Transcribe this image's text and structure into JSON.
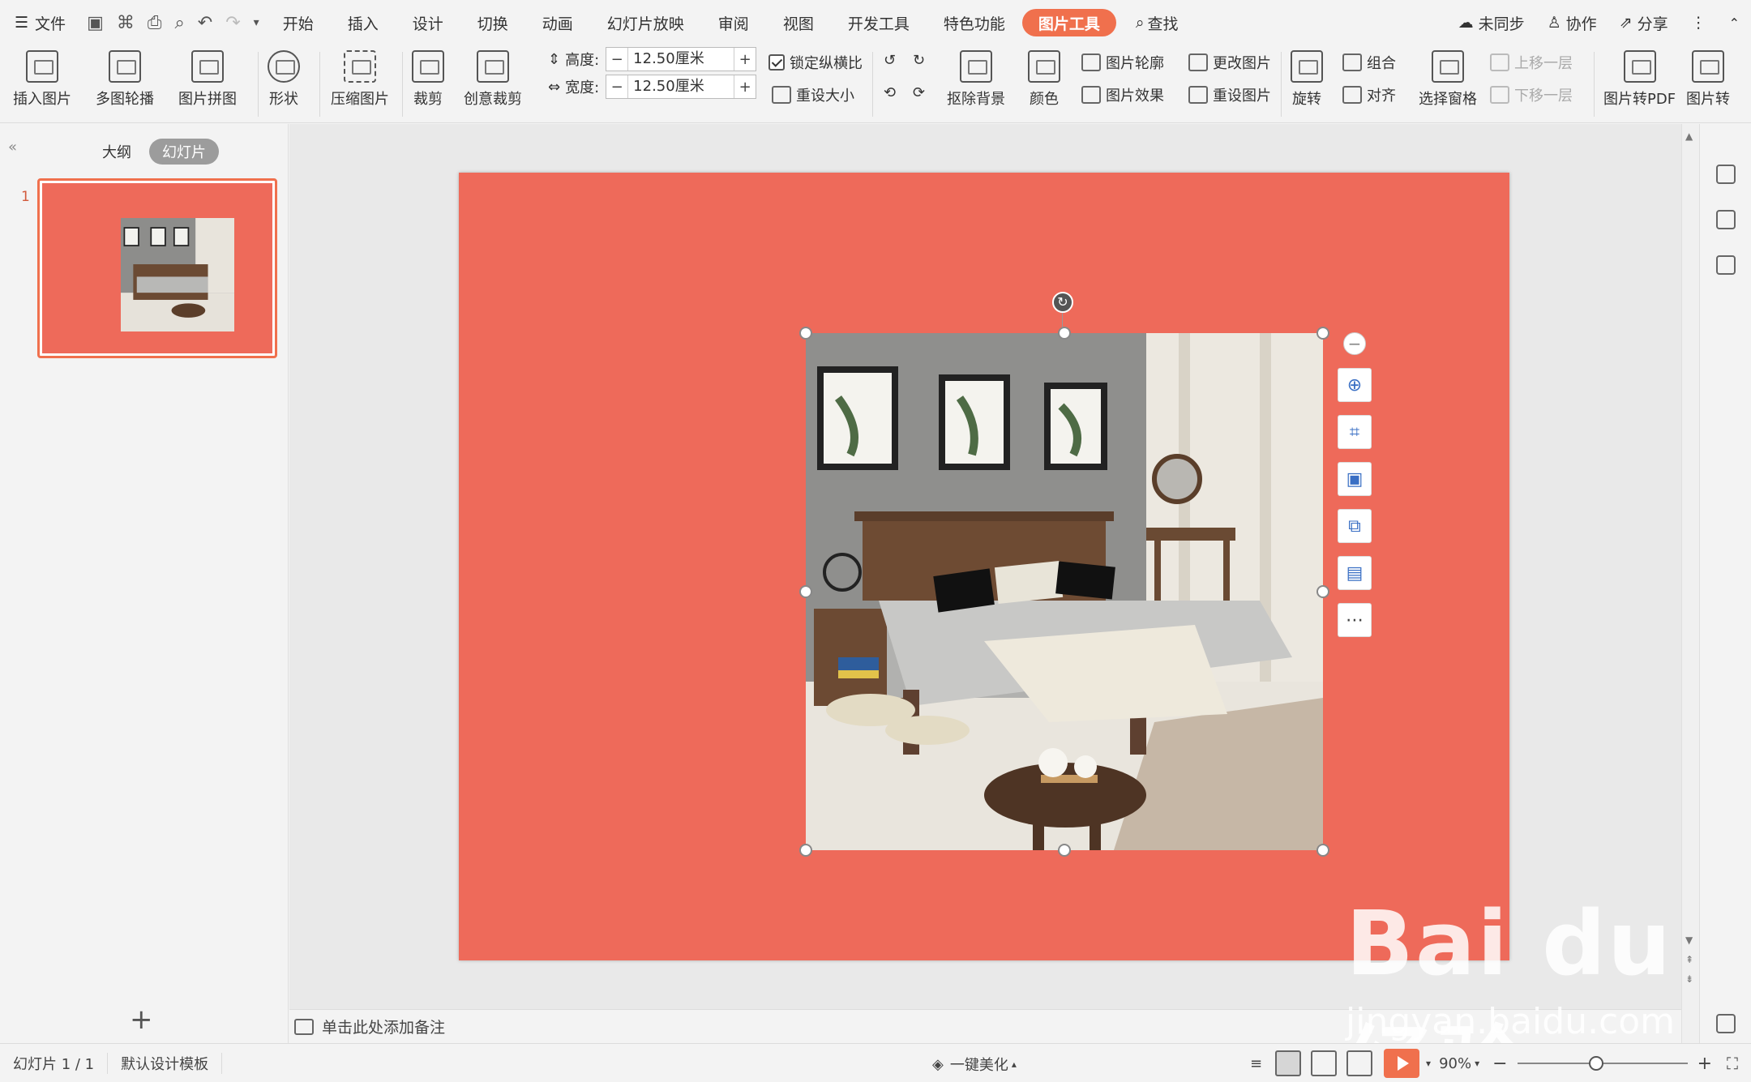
{
  "menubar": {
    "file": "文件",
    "tabs": [
      "开始",
      "插入",
      "设计",
      "切换",
      "动画",
      "幻灯片放映",
      "审阅",
      "视图",
      "开发工具",
      "特色功能",
      "图片工具"
    ],
    "search": "查找",
    "sync": "未同步",
    "collab": "协作",
    "share": "分享"
  },
  "ribbon": {
    "insert_picture": "插入图片",
    "multi_carousel": "多图轮播",
    "collage": "图片拼图",
    "shape": "形状",
    "compress": "压缩图片",
    "crop": "裁剪",
    "creative_crop": "创意裁剪",
    "height_label": "高度:",
    "height_value": "12.50厘米",
    "width_label": "宽度:",
    "width_value": "12.50厘米",
    "lock_ratio": "锁定纵横比",
    "reset_size": "重设大小",
    "remove_bg": "抠除背景",
    "color": "颜色",
    "outline": "图片轮廓",
    "change_picture": "更改图片",
    "effects": "图片效果",
    "reset_picture": "重设图片",
    "rotate": "旋转",
    "group": "组合",
    "align": "对齐",
    "selection_pane": "选择窗格",
    "bring_forward": "上移一层",
    "send_backward": "下移一层",
    "to_pdf": "图片转PDF",
    "to_more": "图片转"
  },
  "leftpane": {
    "outline_tab": "大纲",
    "slides_tab": "幻灯片",
    "slide_number": "1"
  },
  "notes": {
    "placeholder": "单击此处添加备注"
  },
  "statusbar": {
    "slide_info": "幻灯片 1 / 1",
    "template": "默认设计模板",
    "beautify": "一键美化",
    "zoom": "90%"
  },
  "watermark": {
    "brand": "Bai du经验",
    "url": "jingyan.baidu.com"
  },
  "colors": {
    "accent": "#f0704d",
    "slide_bg": "#ee6a5a"
  }
}
